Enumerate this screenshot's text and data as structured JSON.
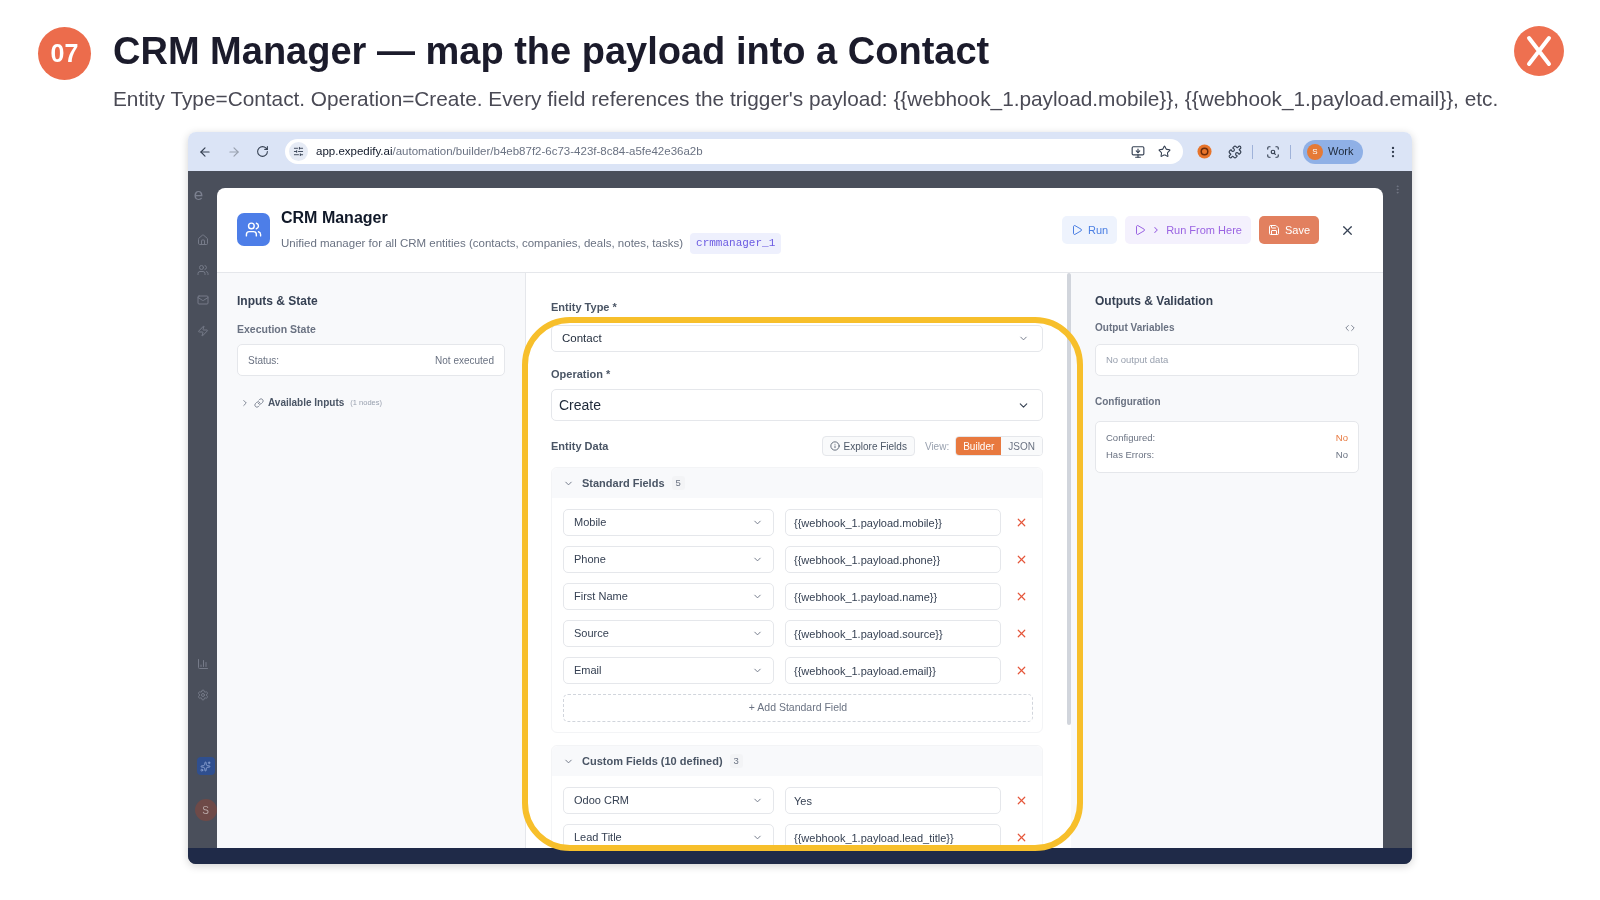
{
  "slide": {
    "number": "07",
    "title": "CRM Manager — map the payload into a Contact",
    "subtitle": "Entity Type=Contact. Operation=Create. Every field references the trigger's payload: {{webhook_1.payload.mobile}}, {{webhook_1.payload.email}}, etc."
  },
  "browser": {
    "url_host": "app.expedify.ai",
    "url_path": "/automation/builder/b4eb87f2-6c73-423f-8c84-a5fe42e36a2b",
    "profile": {
      "initial": "S",
      "label": "Work"
    }
  },
  "background_app": {
    "logo_text": "e",
    "avatar_initial": "S"
  },
  "modal": {
    "title": "CRM Manager",
    "description": "Unified manager for all CRM entities (contacts, companies, deals, notes, tasks)",
    "node_id": "crmmanager_1",
    "actions": [
      {
        "kind": "run",
        "label": "Run"
      },
      {
        "kind": "run_from_here",
        "label": "Run From Here"
      },
      {
        "kind": "save",
        "label": "Save"
      }
    ],
    "inputs_panel": {
      "title": "Inputs & State",
      "execution_state": {
        "label": "Execution State",
        "status_label": "Status:",
        "status_value": "Not executed"
      },
      "available_inputs": {
        "label": "Available Inputs",
        "count": "(1 nodes)",
        "expanded": false
      }
    },
    "form": {
      "entity_type": {
        "label": "Entity Type *",
        "value": "Contact"
      },
      "operation": {
        "label": "Operation *",
        "value": "Create"
      },
      "entity_data": {
        "label": "Entity Data",
        "explore_button": "Explore Fields",
        "view_label": "View:",
        "views": [
          {
            "label": "Builder",
            "selected": true
          },
          {
            "label": "JSON",
            "selected": false
          }
        ]
      },
      "sections": [
        {
          "title": "Standard Fields",
          "count": "5",
          "expanded": true,
          "rows": [
            {
              "field": "Mobile",
              "value": "{{webhook_1.payload.mobile}}"
            },
            {
              "field": "Phone",
              "value": "{{webhook_1.payload.phone}}"
            },
            {
              "field": "First Name",
              "value": "{{webhook_1.payload.name}}"
            },
            {
              "field": "Source",
              "value": "{{webhook_1.payload.source}}"
            },
            {
              "field": "Email",
              "value": "{{webhook_1.payload.email}}"
            }
          ],
          "add_button": "+ Add Standard Field"
        },
        {
          "title": "Custom Fields (10 defined)",
          "count": "3",
          "expanded": true,
          "rows": [
            {
              "field": "Odoo CRM",
              "value": "Yes"
            },
            {
              "field": "Lead Title",
              "value": "{{webhook_1.payload.lead_title}}"
            }
          ]
        }
      ]
    },
    "outputs_panel": {
      "title": "Outputs & Validation",
      "output_variables": {
        "label": "Output Variables",
        "empty_text": "No output data"
      },
      "configuration": {
        "label": "Configuration",
        "items": [
          {
            "label": "Configured:",
            "value": "No",
            "warning": true
          },
          {
            "label": "Has Errors:",
            "value": "No",
            "warning": false
          }
        ]
      }
    }
  }
}
